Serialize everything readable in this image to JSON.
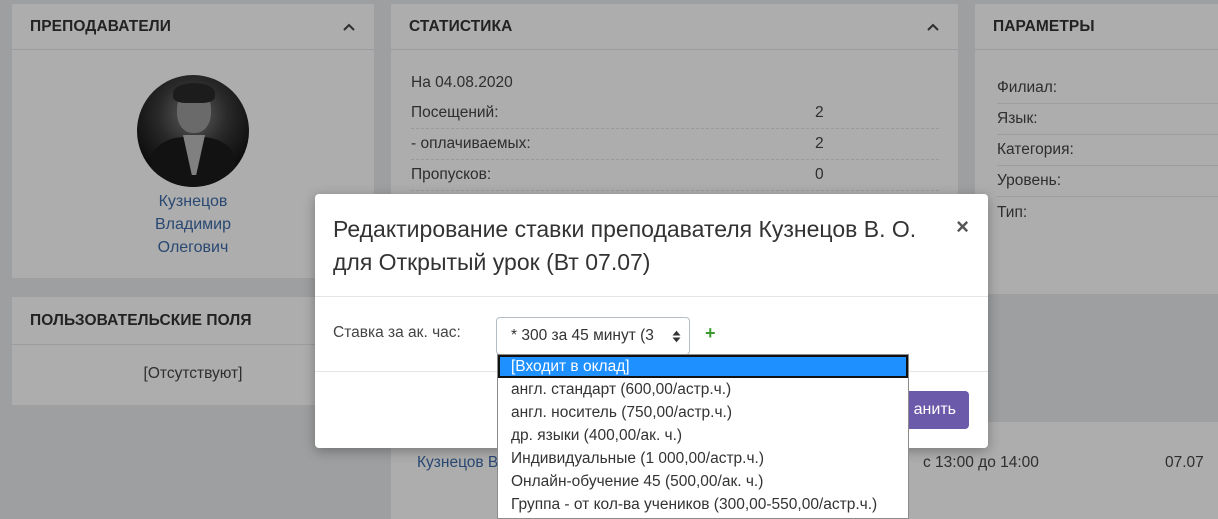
{
  "teachers_panel": {
    "title": "ПРЕПОДАВАТЕЛИ",
    "name_line1": "Кузнецов",
    "name_line2": "Владимир",
    "name_line3": "Олегович"
  },
  "custom_fields_panel": {
    "title": "ПОЛЬЗОВАТЕЛЬСКИЕ ПОЛЯ",
    "empty_text": "[Отсутствуют]"
  },
  "statistics_panel": {
    "title": "СТАТИСТИКА",
    "date_line": "На 04.08.2020",
    "rows": [
      {
        "label": "Посещений:",
        "value": "2"
      },
      {
        "label": "- оплачиваемых:",
        "value": "2"
      },
      {
        "label": "Пропусков:",
        "value": "0"
      }
    ]
  },
  "params_panel": {
    "title": "ПАРАМЕТРЫ",
    "rows": [
      "Филиал:",
      "Язык:",
      "Категория:",
      "Уровень:",
      "Тип:"
    ]
  },
  "lessons_panel": {
    "teacher_link": "Кузнецов В",
    "time": "с 13:00 до 14:00",
    "date": "07.07"
  },
  "modal": {
    "title": "Редактирование ставки преподавателя Кузнецов В. О. для Открытый урок (Вт 07.07)",
    "close_glyph": "×",
    "field_label": "Ставка за ак. час:",
    "select_value": "* 300 за 45 минут (3",
    "add_glyph": "+",
    "save_label": "анить"
  },
  "dropdown": {
    "options": [
      "[Входит в оклад]",
      "англ. стандарт (600,00/астр.ч.)",
      "англ. носитель (750,00/астр.ч.)",
      "др. языки (400,00/ак. ч.)",
      "Индивидуальные (1 000,00/астр.ч.)",
      "Онлайн-обучение 45 (500,00/ак. ч.)",
      "Группа - от кол-ва учеников (300,00-550,00/астр.ч.)"
    ],
    "active_index": 0
  },
  "colors": {
    "link": "#3d6aa8",
    "accent": "#6a5aa9",
    "highlight": "#1e90ff",
    "add": "#3c9a2f"
  }
}
